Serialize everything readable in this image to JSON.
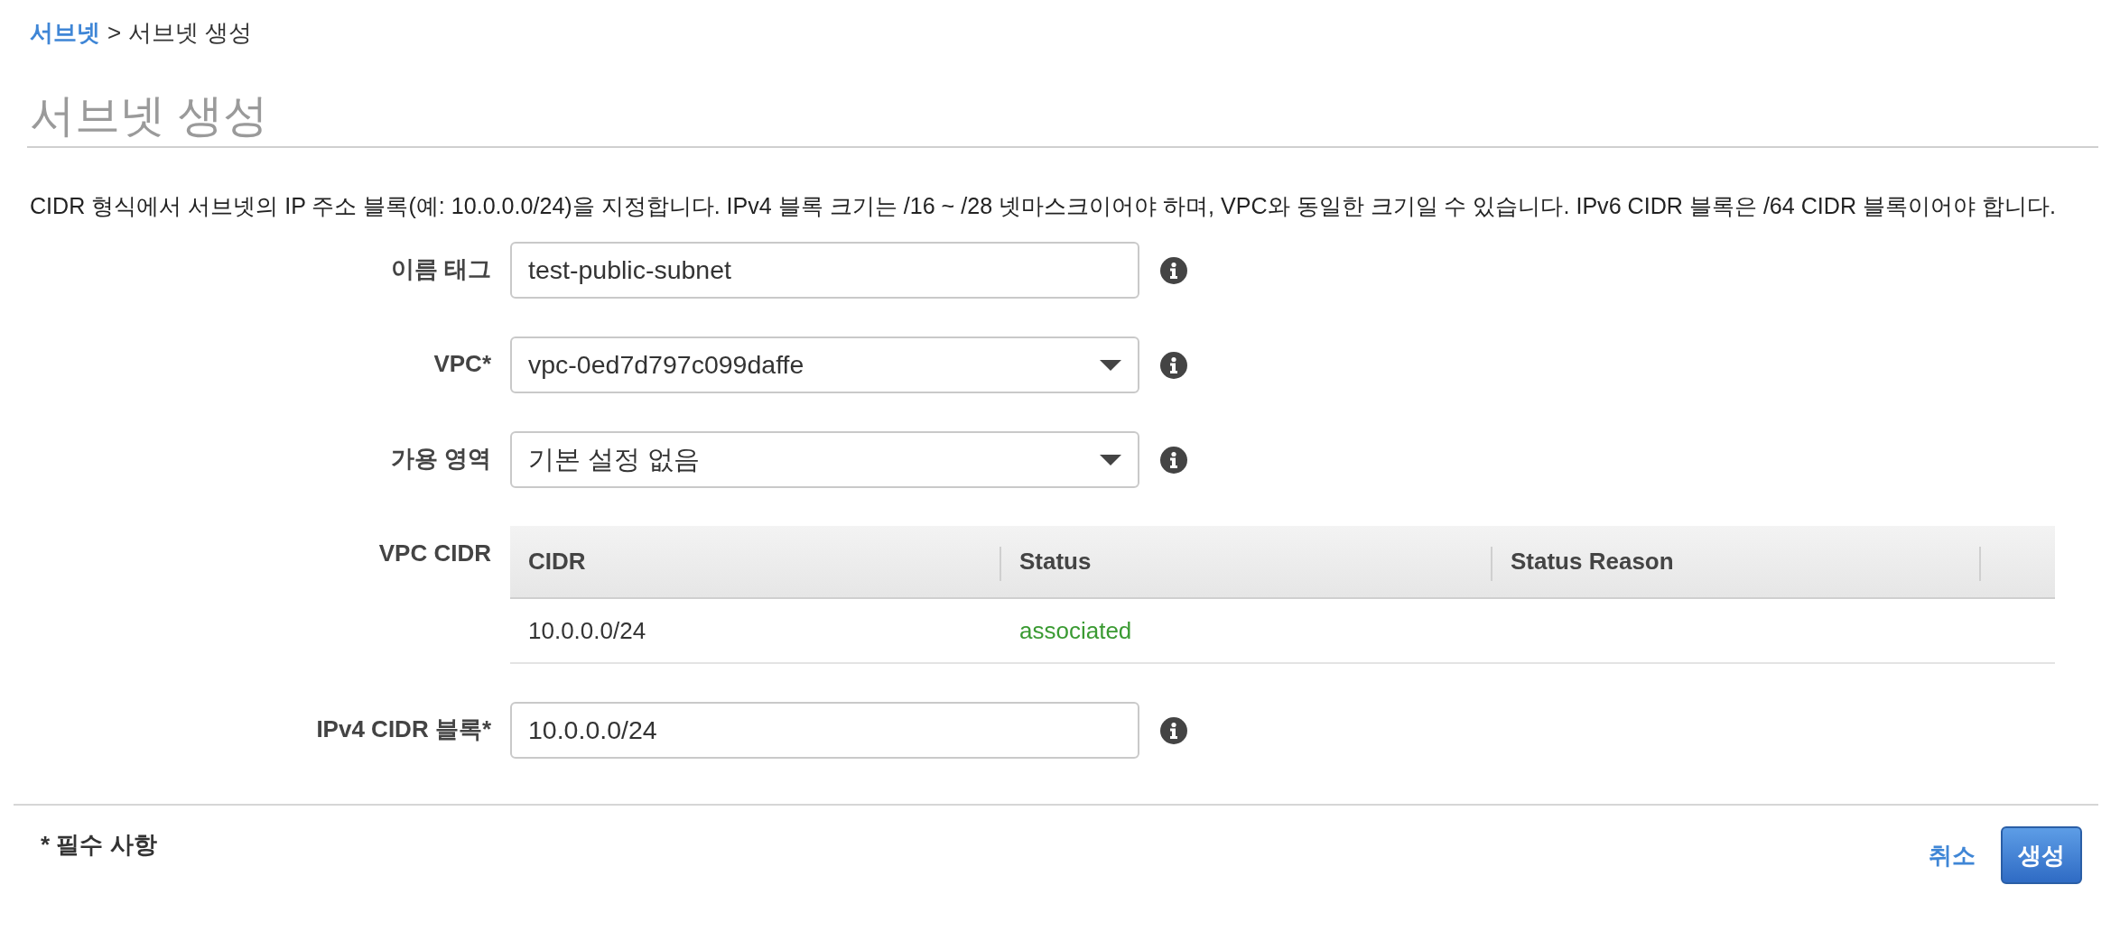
{
  "breadcrumb": {
    "items": [
      {
        "label": "서브넷",
        "kind": "link"
      },
      {
        "label": "서브넷 생성",
        "kind": "current"
      }
    ],
    "separator": ">"
  },
  "page_title": "서브넷 생성",
  "description": "CIDR 형식에서 서브넷의 IP 주소 블록(예: 10.0.0.0/24)을 지정합니다. IPv4 블록 크기는 /16 ~ /28 넷마스크이어야 하며, VPC와 동일한 크기일 수 있습니다. IPv6 CIDR 블록은 /64 CIDR 블록이어야 합니다.",
  "form": {
    "fields": [
      {
        "label": "이름 태그",
        "kind": "text",
        "value": "test-public-subnet",
        "info": true
      },
      {
        "label": "VPC*",
        "kind": "select",
        "value": "vpc-0ed7d797c099daffe",
        "info": true
      },
      {
        "label": "가용 영역",
        "kind": "select",
        "value": "기본 설정 없음",
        "info": true
      },
      {
        "label": "VPC CIDR",
        "kind": "table",
        "info": false,
        "table": {
          "columns": [
            "CIDR",
            "Status",
            "Status Reason"
          ],
          "rows": [
            {
              "cells": [
                {
                  "text": "10.0.0.0/24",
                  "kind": "plain"
                },
                {
                  "text": "associated",
                  "kind": "status"
                }
              ]
            }
          ]
        }
      },
      {
        "label": "IPv4 CIDR 블록*",
        "kind": "text",
        "value": "10.0.0.0/24",
        "info": true
      }
    ]
  },
  "footer": {
    "note": "* 필수 사항",
    "buttons": [
      {
        "label": "취소",
        "kind": "link"
      },
      {
        "label": "생성",
        "kind": "primary"
      }
    ]
  }
}
